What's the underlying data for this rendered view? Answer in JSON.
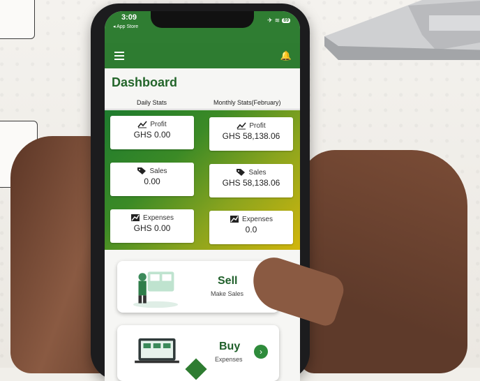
{
  "status_bar": {
    "time": "3:09",
    "back_label": "◂ App Store",
    "battery": "89"
  },
  "dashboard": {
    "title": "Dashboard",
    "tabs": [
      "Daily Stats",
      "Monthly Stats(February)"
    ],
    "daily": [
      {
        "label": "Profit",
        "value": "GHS 0.00",
        "icon": "trend-icon"
      },
      {
        "label": "Sales",
        "value": "0.00",
        "icon": "tag-icon"
      },
      {
        "label": "Expenses",
        "value": "GHS 0.00",
        "icon": "expense-icon"
      }
    ],
    "monthly": [
      {
        "label": "Profit",
        "value": "GHS 58,138.06",
        "icon": "trend-icon"
      },
      {
        "label": "Sales",
        "value": "GHS 58,138.06",
        "icon": "tag-icon"
      },
      {
        "label": "Expenses",
        "value": "0.0",
        "icon": "expense-icon"
      }
    ],
    "actions": [
      {
        "title": "Sell",
        "subtitle": "Make Sales"
      },
      {
        "title": "Buy",
        "subtitle": "Expenses"
      }
    ]
  },
  "colors": {
    "brand_green": "#2e7c31",
    "gradient_end": "#d2b60c"
  }
}
